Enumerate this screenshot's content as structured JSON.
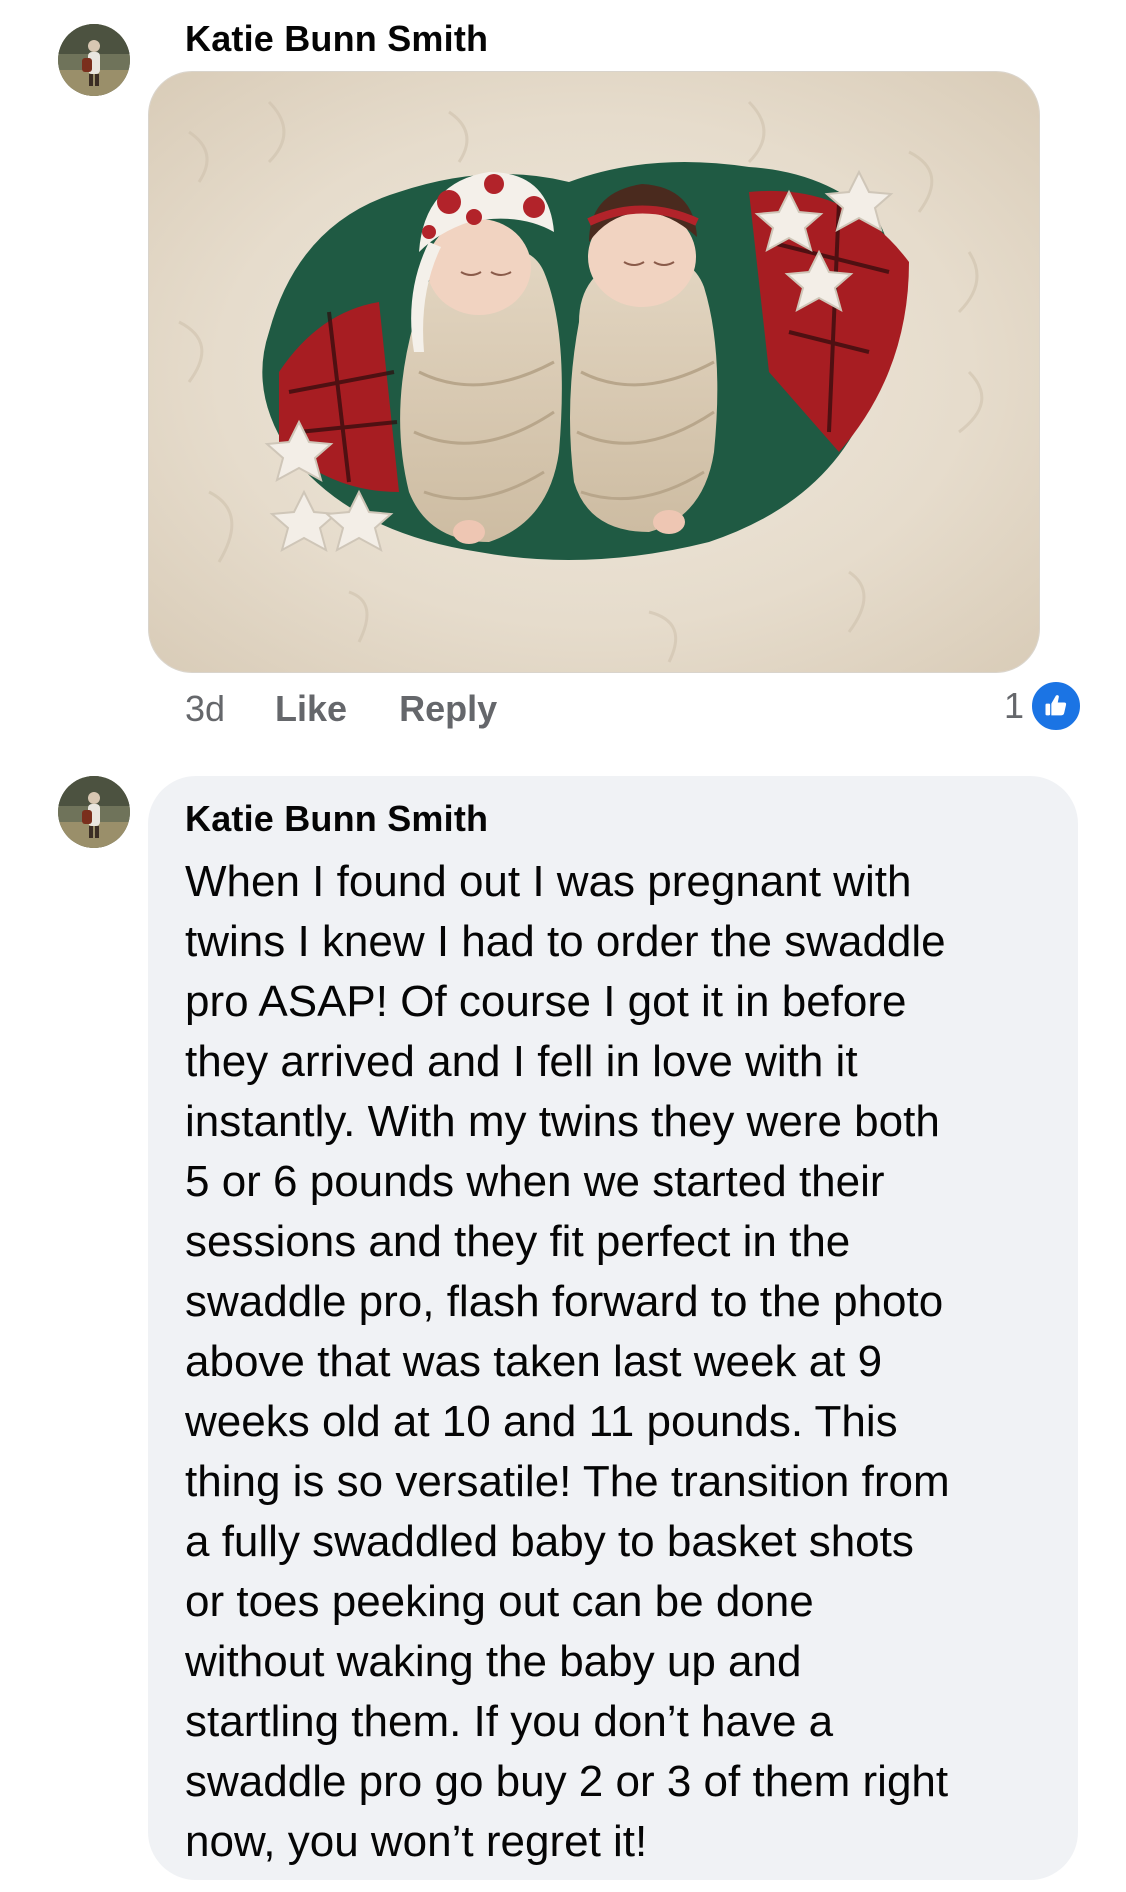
{
  "comments": [
    {
      "author": "Katie Bunn Smith",
      "avatar_icon": "profile-photo",
      "attachment": "photo",
      "timestamp": "3d",
      "like_label": "Like",
      "reply_label": "Reply",
      "reaction_count": "1",
      "reaction_icon": "like-thumb-icon"
    },
    {
      "author": "Katie Bunn Smith",
      "avatar_icon": "profile-photo",
      "text": "When I found out I was pregnant with\ntwins I knew I had to order the swaddle\npro ASAP! Of course I got it in before\nthey arrived and I fell in love with it\ninstantly. With my twins they were both\n5 or 6 pounds when we started their\nsessions and they fit perfect in the\nswaddle pro, flash forward to the photo\nabove that was taken last week at 9\nweeks old at 10 and 11 pounds. This\nthing is so versatile! The transition from\na fully swaddled baby to basket shots\nor toes peeking out can be done\nwithout waking the baby up and\nstartling them. If you don’t have a\nswaddle pro go buy 2 or 3 of them right\nnow, you won’t regret it!"
    }
  ],
  "colors": {
    "like_blue": "#1b74e4",
    "bubble_bg": "#f0f2f5",
    "meta_gray": "#65676b"
  }
}
